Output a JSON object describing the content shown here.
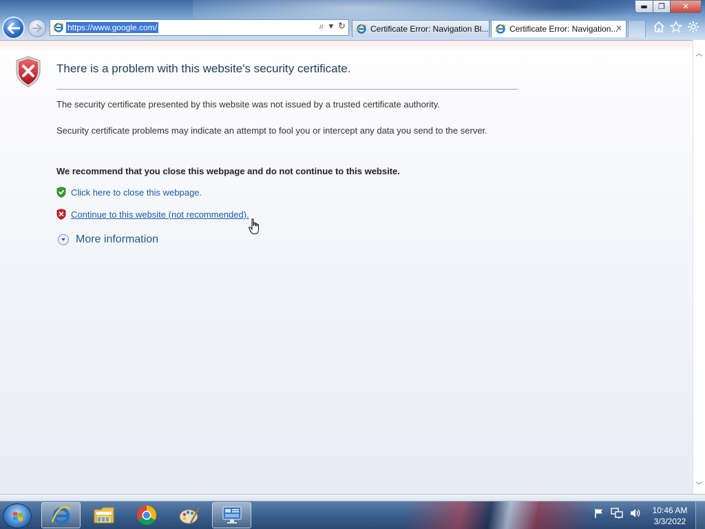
{
  "window": {
    "minimize_glyph": "▬",
    "maximize_glyph": "❐",
    "close_glyph": "✕"
  },
  "address_bar": {
    "url": "https://www.google.com/",
    "search_glyph": "⌕",
    "dropdown_glyph": "▾",
    "refresh_glyph": "↻"
  },
  "tabs": [
    {
      "label": "Certificate Error: Navigation Bl...",
      "active": false
    },
    {
      "label": "Certificate Error: Navigation...",
      "active": true,
      "close_glyph": "✕"
    }
  ],
  "command_icons": [
    "home-icon",
    "favorites-star-icon",
    "tools-gear-icon"
  ],
  "page": {
    "title": "There is a problem with this website's security certificate.",
    "paragraph_1": "The security certificate presented by this website was not issued by a trusted certificate authority.",
    "paragraph_2": "Security certificate problems may indicate an attempt to fool you or intercept any data you send to the server.",
    "recommendation": "We recommend that you close this webpage and do not continue to this website.",
    "close_link": "Click here to close this webpage.",
    "continue_link": "Continue to this website (not recommended).",
    "more_info": "More information"
  },
  "taskbar": {
    "items": [
      "internet-explorer",
      "windows-explorer",
      "google-chrome",
      "paint",
      "remote-desktop"
    ],
    "active_item": "internet-explorer",
    "tray_icons": [
      "action-center-flag-icon",
      "network-icon",
      "volume-icon"
    ],
    "time": "10:46 AM",
    "date": "3/3/2022"
  },
  "colors": {
    "title_color": "#1f3c5b",
    "link_color": "#1a5ca8",
    "error_shield_red": "#c8202a",
    "safe_shield_green": "#3a9a2f"
  }
}
